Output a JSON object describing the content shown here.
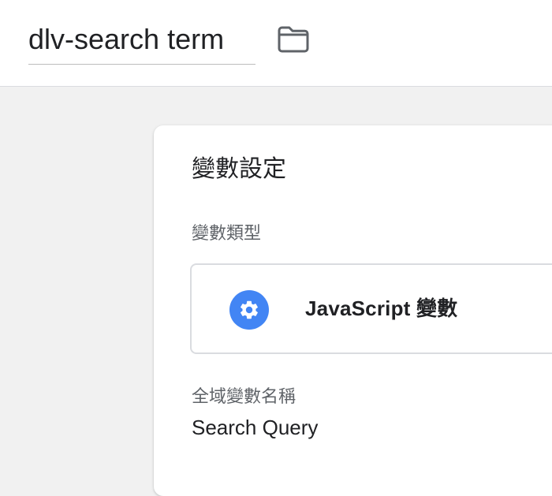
{
  "header": {
    "title": "dlv-search term",
    "folder_icon": "folder-icon"
  },
  "card": {
    "title": "變數設定",
    "variable_type_label": "變數類型",
    "variable_type": {
      "icon": "gear-icon",
      "icon_color": "#4285f4",
      "label": "JavaScript 變數"
    },
    "global_variable_name_label": "全域變數名稱",
    "global_variable_name_value": "Search Query"
  },
  "colors": {
    "background": "#f1f1f1",
    "card": "#ffffff",
    "muted_text": "#5f6368",
    "text": "#202124",
    "accent": "#4285f4",
    "border": "#dadce0"
  }
}
